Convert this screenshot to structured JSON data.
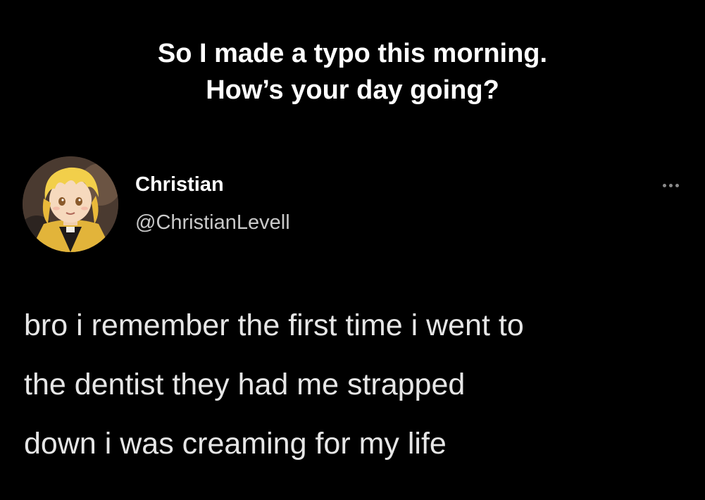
{
  "caption": {
    "line1": "So I made a typo this morning.",
    "line2": "How’s your day going?"
  },
  "tweet": {
    "author": {
      "display_name": "Christian",
      "handle": "@ChristianLevell",
      "avatar_icon": "anime-character-avatar"
    },
    "more_icon": "more-options-icon",
    "text_lines": [
      "bro i remember the first time i went to",
      "the dentist they had me strapped",
      "down i was creaming for my life"
    ]
  },
  "colors": {
    "background": "#000000",
    "caption_text": "#ffffff",
    "handle_text": "#c9c9c9",
    "body_text": "#e6e6e6"
  }
}
